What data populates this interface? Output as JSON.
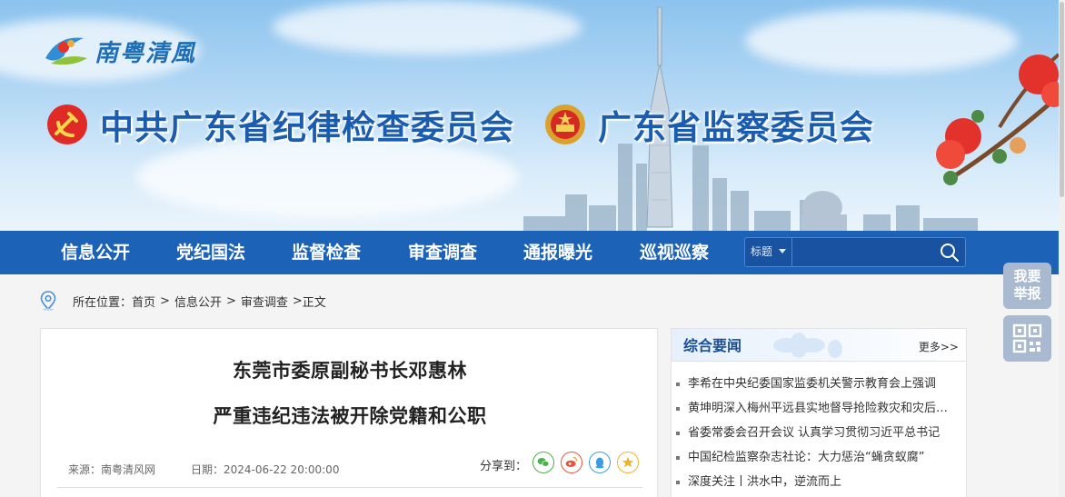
{
  "site": {
    "logo_text": "南粤清風",
    "org_names": [
      "中共广东省纪律检查委员会",
      "广东省监察委员会"
    ]
  },
  "nav": {
    "items": [
      "信息公开",
      "党纪国法",
      "监督检查",
      "审查调查",
      "通报曝光",
      "巡视巡察"
    ],
    "search": {
      "type_label": "标题",
      "placeholder": ""
    }
  },
  "breadcrumb": {
    "prefix": "所在位置：",
    "items": [
      "首页",
      "信息公开",
      "审查调查",
      "正文"
    ],
    "separator": ">"
  },
  "article": {
    "title_line1": "东莞市委原副秘书长邓惠林",
    "title_line2": "严重违纪违法被开除党籍和公职",
    "source": "来源：南粤清风网",
    "date": "日期：2024-06-22 20:00:00",
    "share_label": "分享到：",
    "share_icons": [
      "wechat-icon",
      "weibo-icon",
      "qq-icon",
      "qzone-icon"
    ]
  },
  "sidebar": {
    "title": "综合要闻",
    "more": "更多>>",
    "items": [
      "李希在中央纪委国家监委机关警示教育会上强调",
      "黄坤明深入梅州平远县实地督导抢险救灾和灾后恢复",
      "省委常委会召开会议 认真学习贯彻习近平总书记",
      "中国纪检监察杂志社论：大力惩治“蝇贪蚁腐”",
      "深度关注丨洪水中，逆流而上"
    ]
  },
  "floating": {
    "report_label": "我要\n举报"
  },
  "colors": {
    "nav_bg": "#1c63b8",
    "brand_blue": "#1a5db0",
    "float_bg": "#a9b9cf"
  }
}
